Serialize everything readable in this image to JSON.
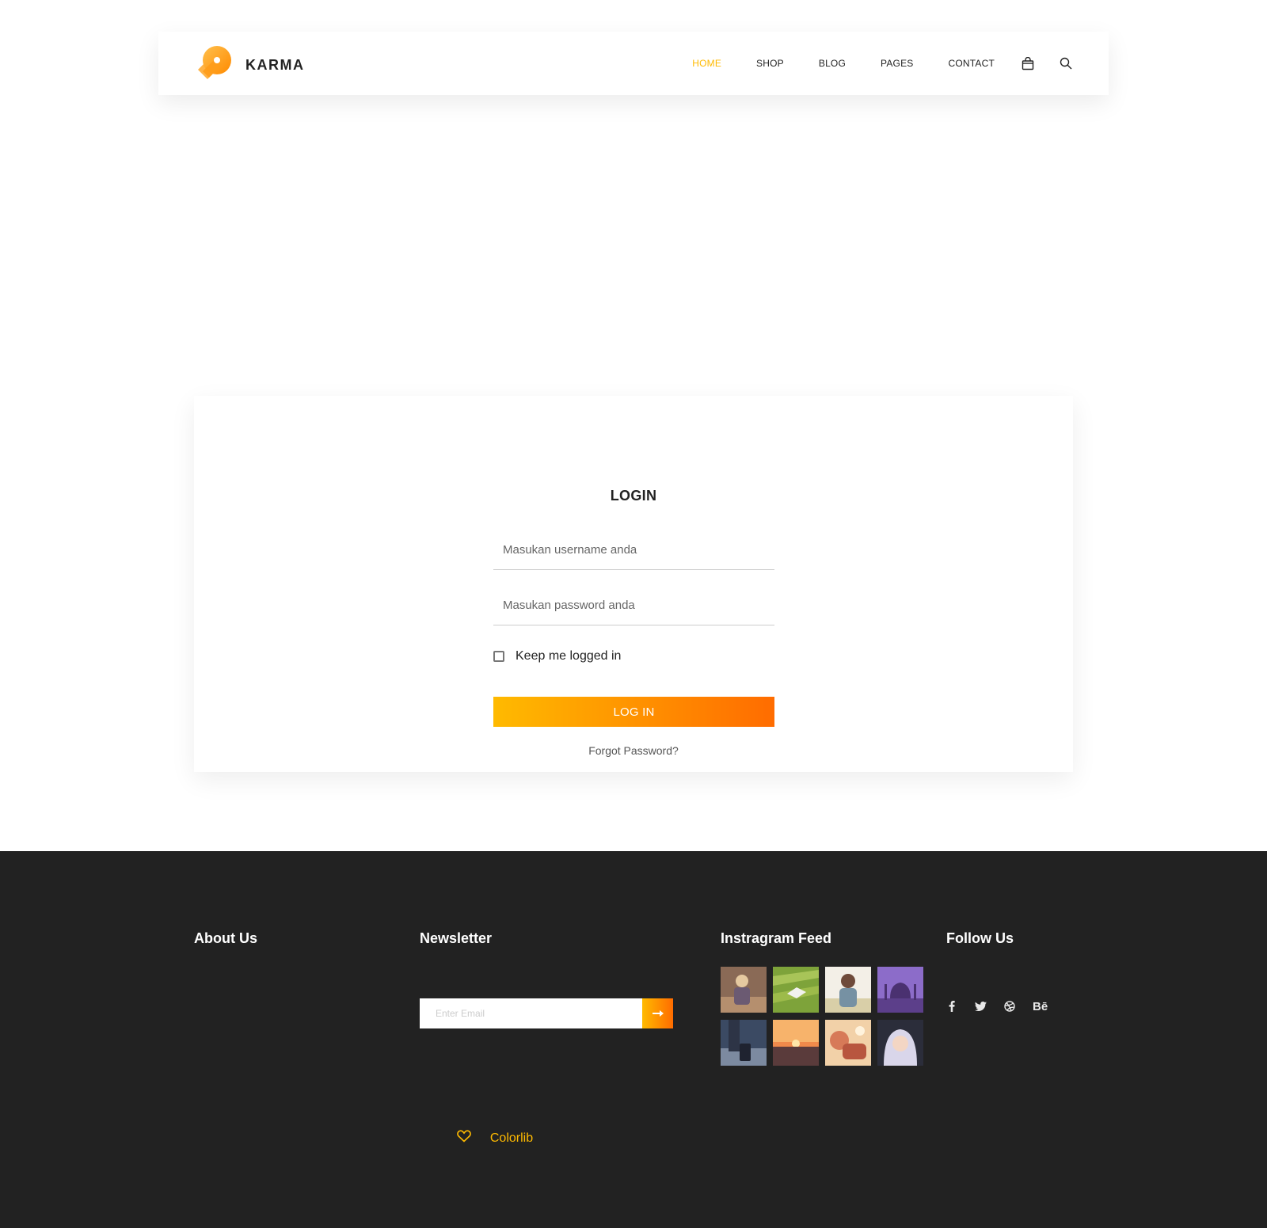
{
  "header": {
    "brand": "KARMA",
    "nav": [
      {
        "label": "HOME",
        "active": true
      },
      {
        "label": "SHOP",
        "active": false
      },
      {
        "label": "BLOG",
        "active": false
      },
      {
        "label": "PAGES",
        "active": false
      },
      {
        "label": "CONTACT",
        "active": false
      }
    ],
    "icons": [
      "shopping-bag-icon",
      "search-icon"
    ]
  },
  "login": {
    "title": "LOGIN",
    "username_placeholder": "Masukan username anda",
    "password_placeholder": "Masukan password anda",
    "remember_label": "Keep me logged in",
    "remember_checked": false,
    "submit_label": "LOG IN",
    "forgot_label": "Forgot Password?"
  },
  "footer": {
    "about_title": "About Us",
    "newsletter_title": "Newsletter",
    "newsletter_placeholder": "Enter Email",
    "instagram_title": "Instragram Feed",
    "follow_title": "Follow Us",
    "social": [
      "facebook-icon",
      "twitter-icon",
      "dribbble-icon",
      "behance-icon"
    ],
    "behance_text": "Bē",
    "credit_link": "Colorlib"
  },
  "colors": {
    "accent": "#ffba00",
    "accent_end": "#ff6c00",
    "footer_bg": "#222222"
  }
}
